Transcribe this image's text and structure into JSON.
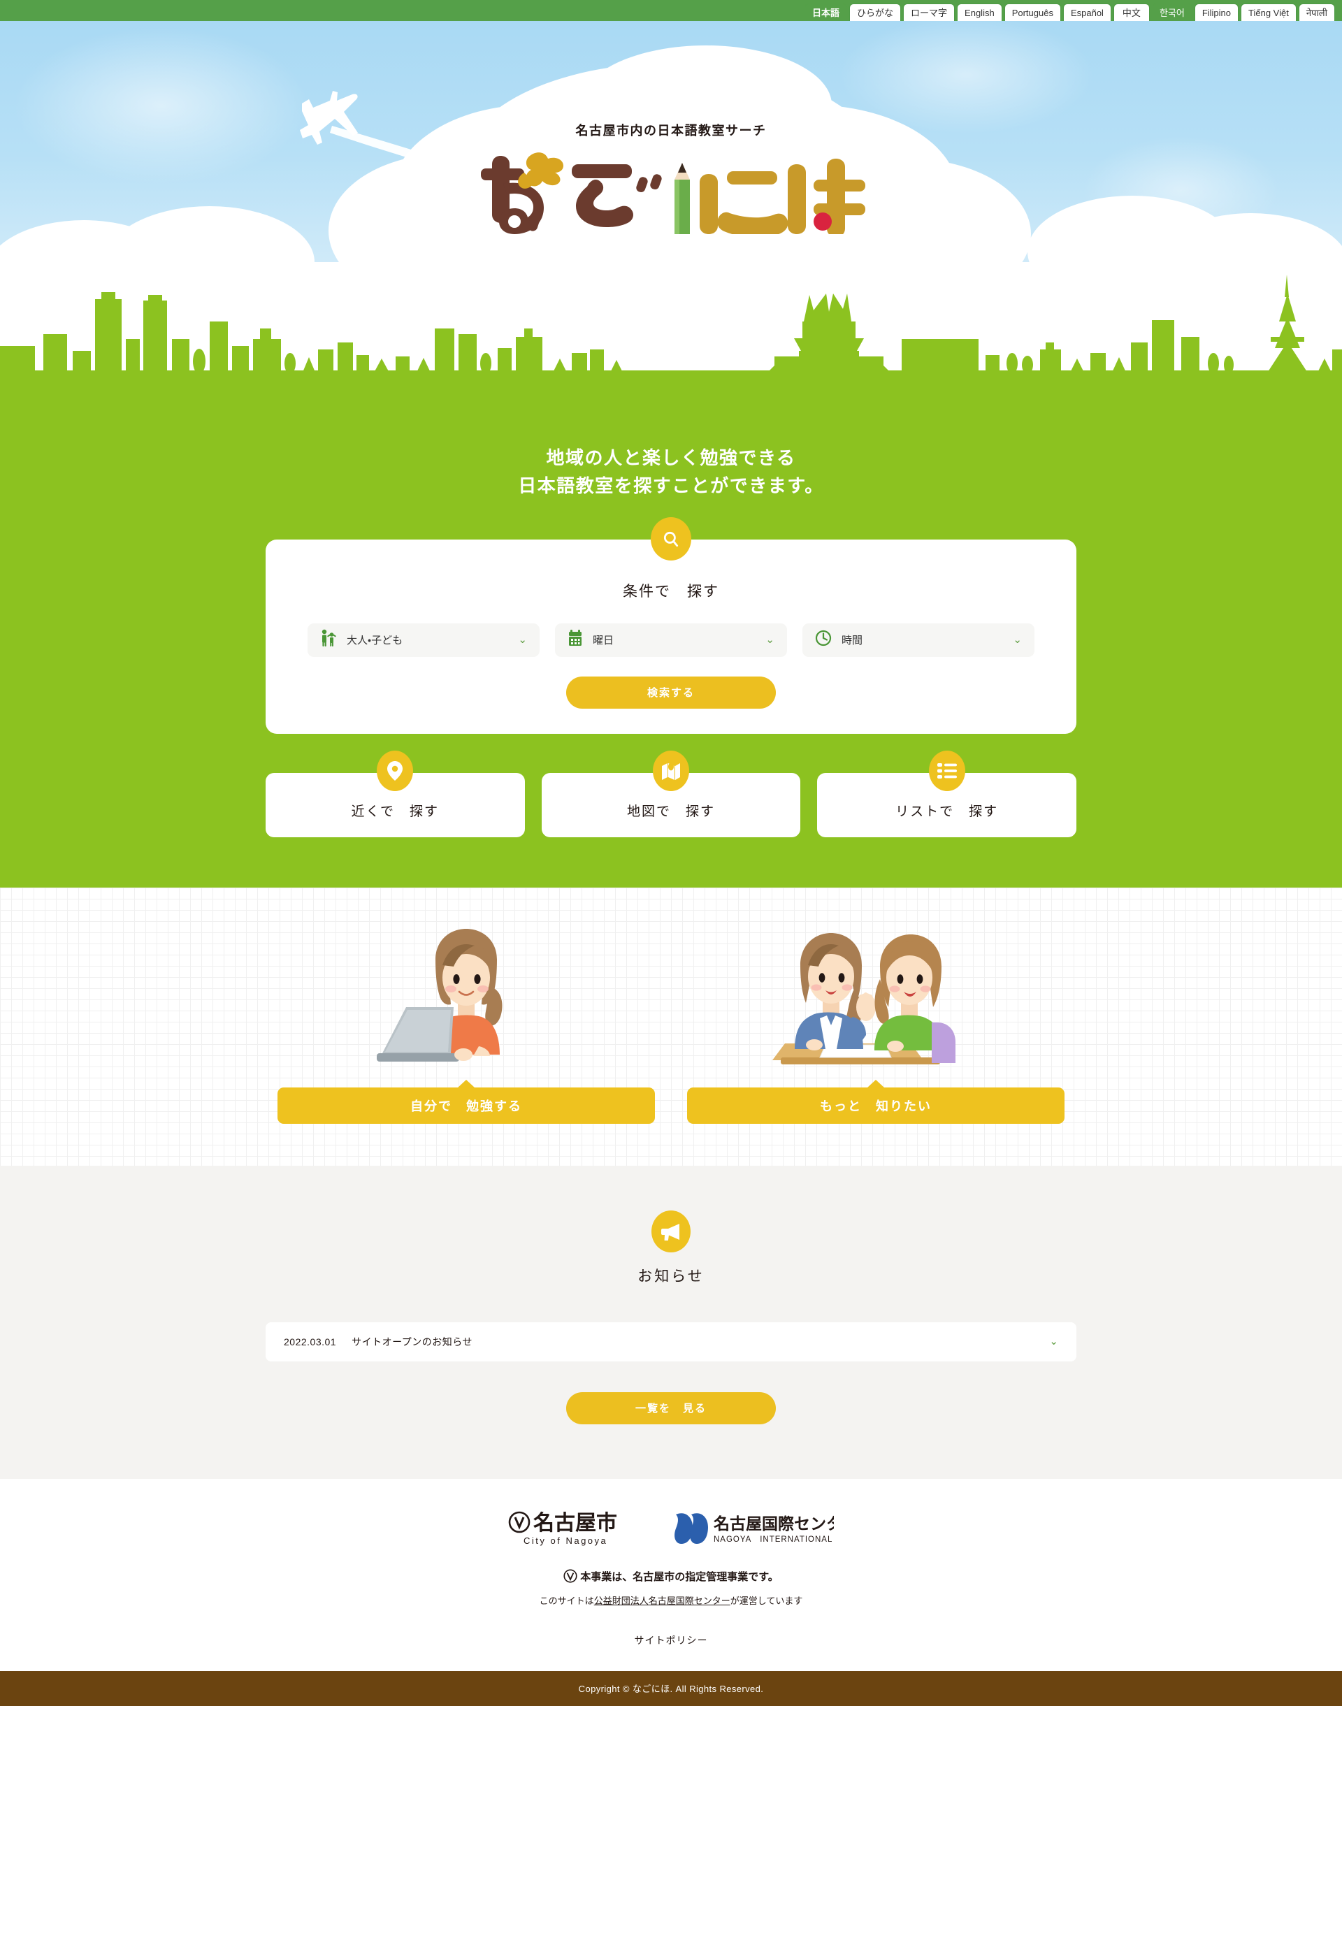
{
  "language_bar": {
    "tabs": [
      {
        "label": "日本語",
        "state": "active"
      },
      {
        "label": "ひらがな",
        "state": "normal"
      },
      {
        "label": "ローマ字",
        "state": "normal"
      },
      {
        "label": "English",
        "state": "normal"
      },
      {
        "label": "Português",
        "state": "normal"
      },
      {
        "label": "Español",
        "state": "normal"
      },
      {
        "label": "中文",
        "state": "normal"
      },
      {
        "label": "한국어",
        "state": "hovered"
      },
      {
        "label": "Filipino",
        "state": "normal"
      },
      {
        "label": "Tiếng Việt",
        "state": "normal"
      },
      {
        "label": "नेपाली",
        "state": "normal"
      }
    ]
  },
  "hero": {
    "tagline": "名古屋市内の日本語教室サーチ",
    "logo_text": "なごにほ",
    "logo_chars": [
      "な",
      "ご",
      "に",
      "ほ"
    ]
  },
  "green_section": {
    "headline_line1": "地域の人と楽しく勉強できる",
    "headline_line2": "日本語教室を探すことができます。",
    "search_card": {
      "icon": "search-icon",
      "title": "条件で　探す",
      "selects": [
        {
          "icon": "adult-child-icon",
          "value": "大人・子ども",
          "chevron": "⌄"
        },
        {
          "icon": "calendar-icon",
          "value": "曜日",
          "chevron": "⌄"
        },
        {
          "icon": "clock-icon",
          "value": "時間",
          "chevron": "⌄"
        }
      ],
      "submit_label": "検索する"
    },
    "quick_cards": [
      {
        "icon": "map-pin-icon",
        "label": "近くで　探す"
      },
      {
        "icon": "map-icon",
        "label": "地図で　探す"
      },
      {
        "icon": "list-icon",
        "label": "リストで　探す"
      }
    ]
  },
  "illustration_section": {
    "cards": [
      {
        "art": "woman-with-laptop-illustration",
        "banner_label": "自分で　勉強する"
      },
      {
        "art": "two-women-talking-illustration",
        "banner_label": "もっと　知りたい"
      }
    ]
  },
  "news_section": {
    "icon": "megaphone-icon",
    "title": "お知らせ",
    "items": [
      {
        "date": "2022.03.01",
        "text": "サイトオープンのお知らせ",
        "chevron": "⌄"
      }
    ],
    "more_label": "一覧を　見る"
  },
  "footer": {
    "logos": [
      {
        "name": "nagoya-city-logo",
        "jp": "名古屋市",
        "en": "City of Nagoya"
      },
      {
        "name": "nagoya-international-center-logo",
        "jp": "名古屋国際センター",
        "en": "NAGOYA　INTERNATIONAL　CENTER"
      }
    ],
    "note_bold": "本事業は、名古屋市の指定管理事業です。",
    "note_pre": "このサイトは",
    "note_link": "公益財団法人名古屋国際センター",
    "note_post": "が運営しています",
    "policy_label": "サイトポリシー",
    "copyright": "Copyright © なごにほ. All Rights Reserved."
  },
  "colors": {
    "green_brand": "#8cc220",
    "green_tab": "#55a049",
    "yellow": "#eec21f",
    "brown_footer": "#6b4410",
    "sky": "#b7e0f6",
    "logo_brown": "#6b3b2e",
    "logo_gold": "#c89a2a"
  }
}
